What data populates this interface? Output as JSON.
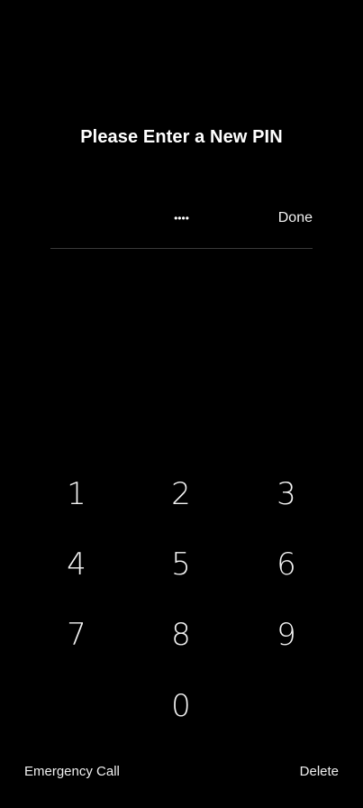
{
  "header": {
    "title": "Please Enter a New PIN"
  },
  "pin": {
    "masked_value": "••••",
    "done_label": "Done"
  },
  "keypad": {
    "keys": [
      "1",
      "2",
      "3",
      "4",
      "5",
      "6",
      "7",
      "8",
      "9",
      "0"
    ]
  },
  "footer": {
    "emergency_label": "Emergency Call",
    "delete_label": "Delete"
  }
}
